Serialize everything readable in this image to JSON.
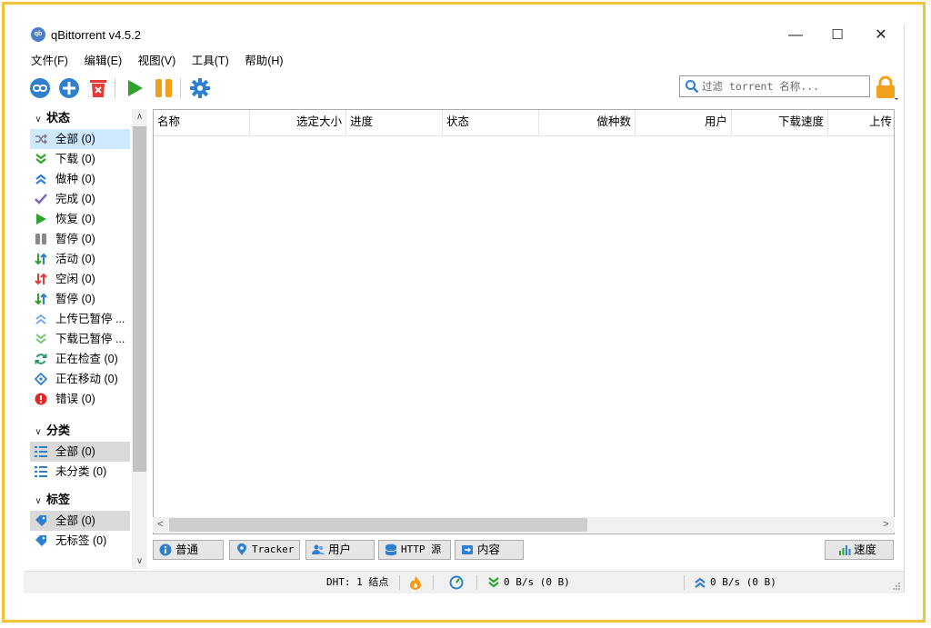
{
  "window": {
    "title": "qBittorrent v4.5.2",
    "logo_text": "qb",
    "controls": {
      "minimize": "—",
      "maximize": "☐",
      "close": "✕"
    }
  },
  "menu": [
    "文件(F)",
    "编辑(E)",
    "视图(V)",
    "工具(T)",
    "帮助(H)"
  ],
  "toolbar": {
    "icons": [
      "link-icon",
      "add-torrent-icon",
      "delete-icon",
      "resume-icon",
      "pause-icon",
      "options-icon"
    ],
    "search_placeholder": "过滤 torrent 名称...",
    "lock_icon": "lock-icon"
  },
  "sidebar": {
    "status": {
      "heading": "状态",
      "items": [
        {
          "label": "全部 (0)",
          "icon": "all-shuffle-icon",
          "selected": true
        },
        {
          "label": "下载 (0)",
          "icon": "downloading-icon"
        },
        {
          "label": "做种 (0)",
          "icon": "seeding-icon"
        },
        {
          "label": "完成 (0)",
          "icon": "completed-icon"
        },
        {
          "label": "恢复 (0)",
          "icon": "resumed-icon"
        },
        {
          "label": "暂停 (0)",
          "icon": "paused-icon"
        },
        {
          "label": "活动 (0)",
          "icon": "active-icon"
        },
        {
          "label": "空闲 (0)",
          "icon": "inactive-icon"
        },
        {
          "label": "暂停 (0)",
          "icon": "stalled-icon"
        },
        {
          "label": "上传已暂停 ...",
          "icon": "stalled-upload-icon"
        },
        {
          "label": "下载已暂停 ...",
          "icon": "stalled-download-icon"
        },
        {
          "label": "正在检查 (0)",
          "icon": "checking-icon"
        },
        {
          "label": "正在移动 (0)",
          "icon": "moving-icon"
        },
        {
          "label": "错误 (0)",
          "icon": "error-icon"
        }
      ]
    },
    "categories": {
      "heading": "分类",
      "items": [
        {
          "label": "全部 (0)",
          "icon": "list-icon"
        },
        {
          "label": "未分类 (0)",
          "icon": "list-icon"
        }
      ]
    },
    "tags": {
      "heading": "标签",
      "items": [
        {
          "label": "全部 (0)",
          "icon": "tag-icon"
        },
        {
          "label": "无标签 (0)",
          "icon": "tag-icon"
        }
      ]
    }
  },
  "table": {
    "columns": [
      "名称",
      "选定大小",
      "进度",
      "状态",
      "做种数",
      "用户",
      "下载速度",
      "上传"
    ],
    "rows": []
  },
  "tabs": [
    "普通",
    "Tracker",
    "用户",
    "HTTP 源",
    "内容"
  ],
  "speed_button": "速度",
  "status": {
    "dht": "DHT: 1 结点",
    "download": "0 B/s (0 B)",
    "upload": "0 B/s (0 B)"
  },
  "colors": {
    "accent": "#2f7fd1",
    "green": "#2aa52a",
    "orange": "#f2a01b",
    "red": "#e33b36",
    "border_frame": "#f0c43a"
  }
}
